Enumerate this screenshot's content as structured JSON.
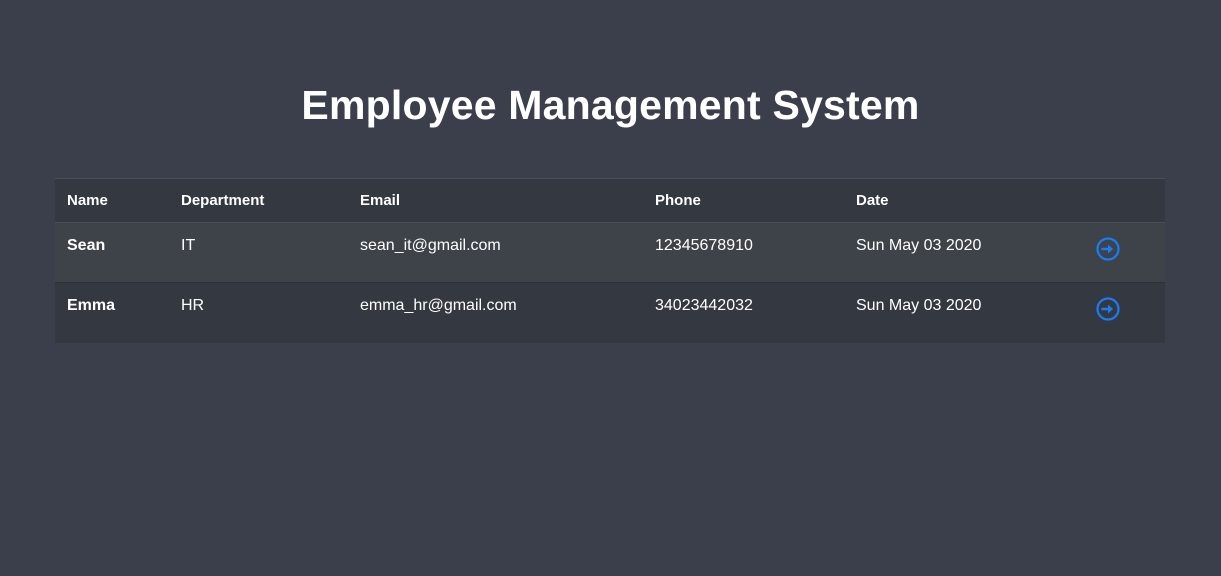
{
  "header": {
    "title": "Employee Management System"
  },
  "table": {
    "columns": [
      "Name",
      "Department",
      "Email",
      "Phone",
      "Date"
    ],
    "rows": [
      {
        "name": "Sean",
        "department": "IT",
        "email": "sean_it@gmail.com",
        "phone": "12345678910",
        "date": "Sun May 03 2020"
      },
      {
        "name": "Emma",
        "department": "HR",
        "email": "emma_hr@gmail.com",
        "phone": "34023442032",
        "date": "Sun May 03 2020"
      }
    ]
  },
  "colors": {
    "background": "#3b3f4c",
    "accent": "#1a7cf4"
  },
  "icons": {
    "row_action": "arrow-right-circle-icon"
  }
}
